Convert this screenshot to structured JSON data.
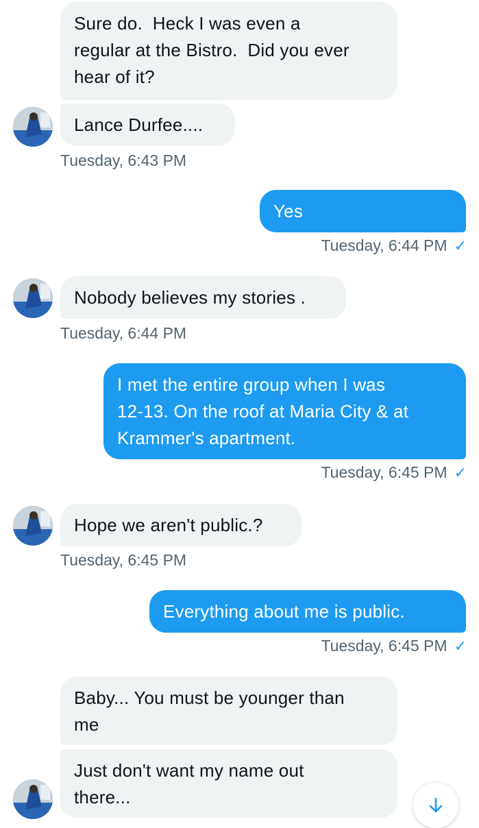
{
  "messages": [
    {
      "id": "m1",
      "dir": "in",
      "text": "Sure do.  Heck I was even a\nregular at the Bistro.  Did you ever\nhear of it?"
    },
    {
      "id": "m2",
      "dir": "in",
      "text": "Lance Durfee...."
    },
    {
      "id": "m3",
      "dir": "out",
      "text": "Yes"
    },
    {
      "id": "m4",
      "dir": "in",
      "text": "Nobody believes my stories ."
    },
    {
      "id": "m5",
      "dir": "out",
      "text": "I met the entire group when I was\n12-13. On the roof at Maria City & at\nKrammer's apartment."
    },
    {
      "id": "m6",
      "dir": "in",
      "text": "Hope we aren't public.?"
    },
    {
      "id": "m7",
      "dir": "out",
      "text": "Everything about me is public."
    },
    {
      "id": "m8",
      "dir": "in",
      "text": "Baby... You must be younger than\nme"
    },
    {
      "id": "m9",
      "dir": "in",
      "text": "Just don't want my name out\nthere..."
    }
  ],
  "timestamps": {
    "t1": "Tuesday, 6:43 PM",
    "t2": "Tuesday, 6:44 PM",
    "t3": "Tuesday, 6:44 PM",
    "t4": "Tuesday, 6:45 PM",
    "t5": "Tuesday, 6:45 PM",
    "t6": "Tuesday, 6:45 PM"
  },
  "read_mark": "✓",
  "icons": {
    "avatar": "contact-avatar",
    "scroll_down": "arrow-down-icon"
  },
  "colors": {
    "outgoing_bubble": "#1d9bf0",
    "incoming_bubble": "#eff3f4",
    "timestamp_text": "#536471"
  }
}
